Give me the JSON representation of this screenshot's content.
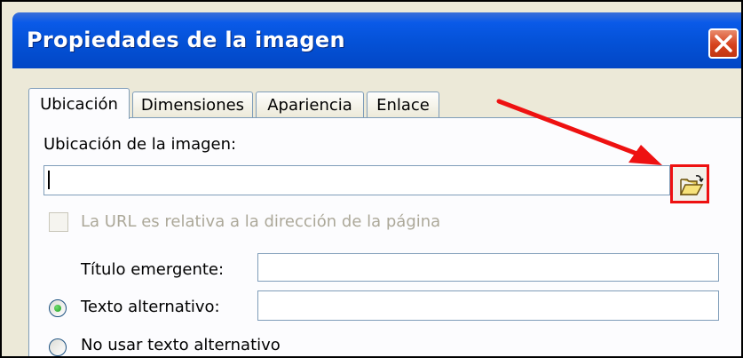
{
  "window": {
    "title": "Propiedades de la imagen",
    "close_symbol": "✕"
  },
  "tabs": [
    {
      "label": "Ubicación",
      "active": true
    },
    {
      "label": "Dimensiones",
      "active": false
    },
    {
      "label": "Apariencia",
      "active": false
    },
    {
      "label": "Enlace",
      "active": false
    }
  ],
  "location": {
    "label": "Ubicación de la imagen:",
    "value": "",
    "browse_icon": "open-folder-icon"
  },
  "relative_url": {
    "label": "La URL es relativa a la dirección de la página",
    "checked": false,
    "enabled": false
  },
  "tooltip": {
    "label": "Título emergente:",
    "value": ""
  },
  "alt_text": {
    "label": "Texto alternativo:",
    "value": "",
    "selected": true
  },
  "no_alt_text": {
    "label": "No usar texto alternativo",
    "selected": false
  },
  "colors": {
    "accent": "#0451d6",
    "highlight": "#ee1111"
  }
}
